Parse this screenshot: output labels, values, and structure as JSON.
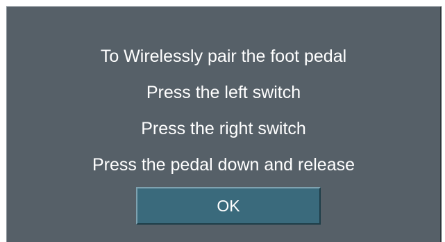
{
  "dialog": {
    "lines": [
      "To Wirelessly pair the foot pedal",
      "Press the left switch",
      "Press the right switch",
      "Press the pedal down and release"
    ],
    "ok_label": "OK"
  },
  "colors": {
    "dialog_background": "#566068",
    "button_background": "#3a6a7c",
    "text": "#ffffff"
  }
}
